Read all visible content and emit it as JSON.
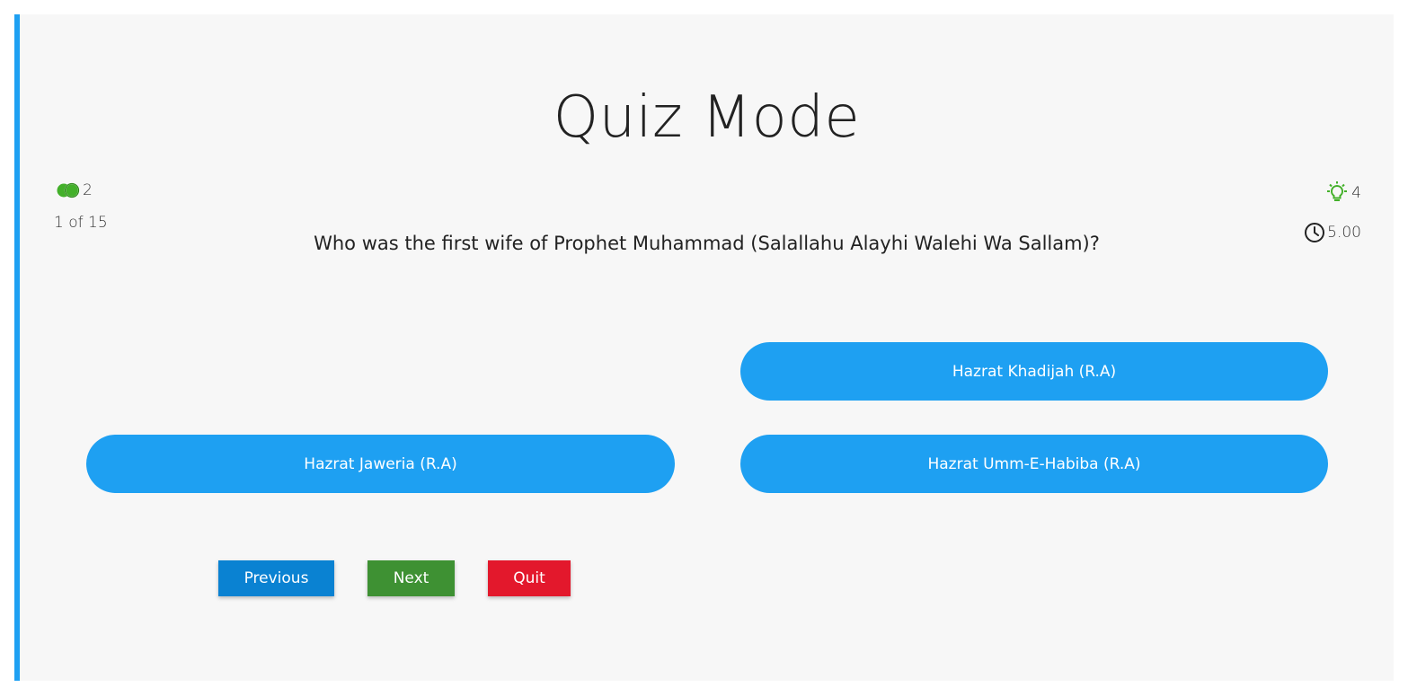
{
  "page": {
    "title": "Quiz Mode"
  },
  "stats": {
    "lifelines": "2",
    "progress": "1 of 15",
    "hints": "4",
    "timer": "5.00"
  },
  "question": {
    "text": "Who was the first wife of Prophet Muhammad (Salallahu Alayhi Walehi Wa Sallam)?"
  },
  "answers": [
    {
      "label": "Hazrat Khadijah (R.A)"
    },
    {
      "label": "Hazrat Jaweria (R.A)"
    },
    {
      "label": "Hazrat Umm-E-Habiba (R.A)"
    }
  ],
  "nav": {
    "previous_label": "Previous",
    "next_label": "Next",
    "quit_label": "Quit"
  },
  "icons": {
    "lifeline": "two-circles-icon",
    "hint": "lightbulb-icon",
    "timer": "clock-icon"
  },
  "colors": {
    "accent": "#1ea0f2",
    "previous": "#0a82d2",
    "next": "#3e9133",
    "quit": "#e3182c",
    "hint_icon": "#43b02a"
  }
}
